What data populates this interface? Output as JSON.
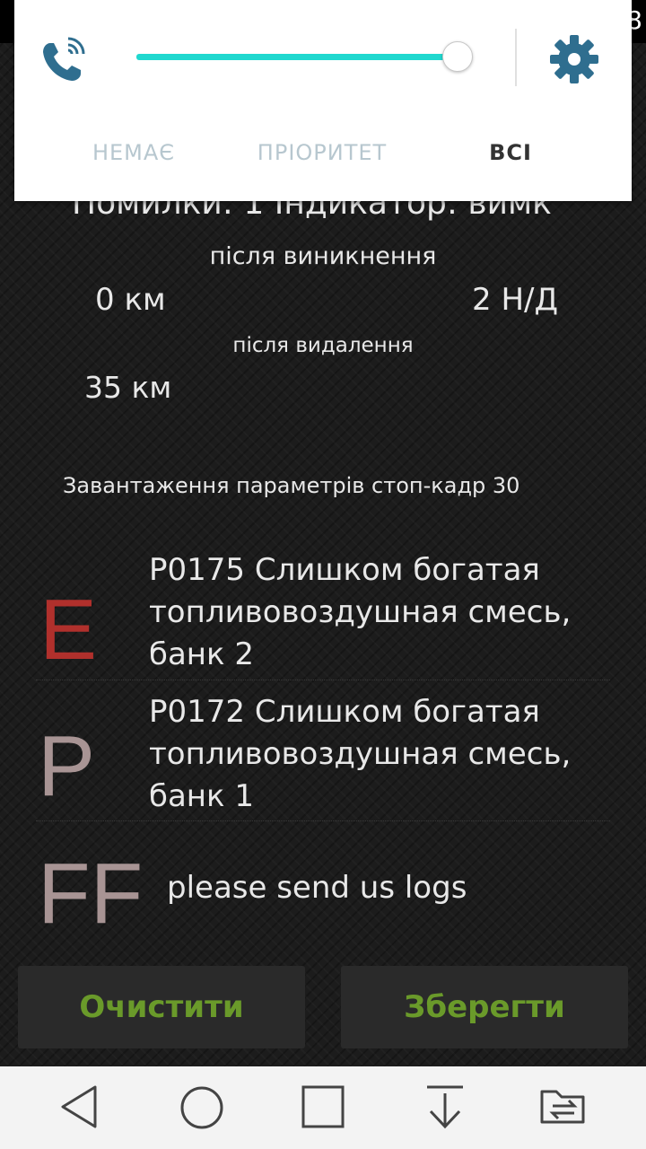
{
  "statusbar": {
    "clock_tail": "8"
  },
  "notification_panel": {
    "tabs": [
      {
        "label": "НЕМАЄ"
      },
      {
        "label": "ПРІОРИТЕТ"
      },
      {
        "label": "ВСІ"
      }
    ],
    "selected_tab": "ВСІ",
    "volume_level": 1.0,
    "accent_color": "#20d8cf"
  },
  "main": {
    "errors_line": "Помилки: 1 Індикатор: вимк",
    "after_occurrence_label": "після виникнення",
    "after_occurrence_value": "0 км",
    "status_value": "2 Н/Д",
    "after_deletion_label": "після видалення",
    "after_deletion_value": "35 км",
    "freeze_frame_label": "Завантаження параметрів стоп-кадр 30",
    "codes": [
      {
        "letter": "E",
        "letter_color": "#b0302c",
        "code": "P0175",
        "description": "Слишком богатая топливовоздушная смесь, банк 2"
      },
      {
        "letter": "P",
        "letter_color": "#a89494",
        "code": "P0172",
        "description": "Слишком богатая топливовоздушная смесь, банк 1"
      },
      {
        "letter": "FF",
        "letter_color": "#a89494",
        "code": "",
        "description": "please send us logs"
      }
    ]
  },
  "buttons": {
    "clear_label": "Очистити",
    "save_label": "Зберегти",
    "text_color": "#6a9a2a"
  },
  "navbar": {
    "icons": [
      "back-icon",
      "home-icon",
      "recents-icon",
      "notification-pulldown-icon",
      "switch-sim-icon"
    ]
  }
}
